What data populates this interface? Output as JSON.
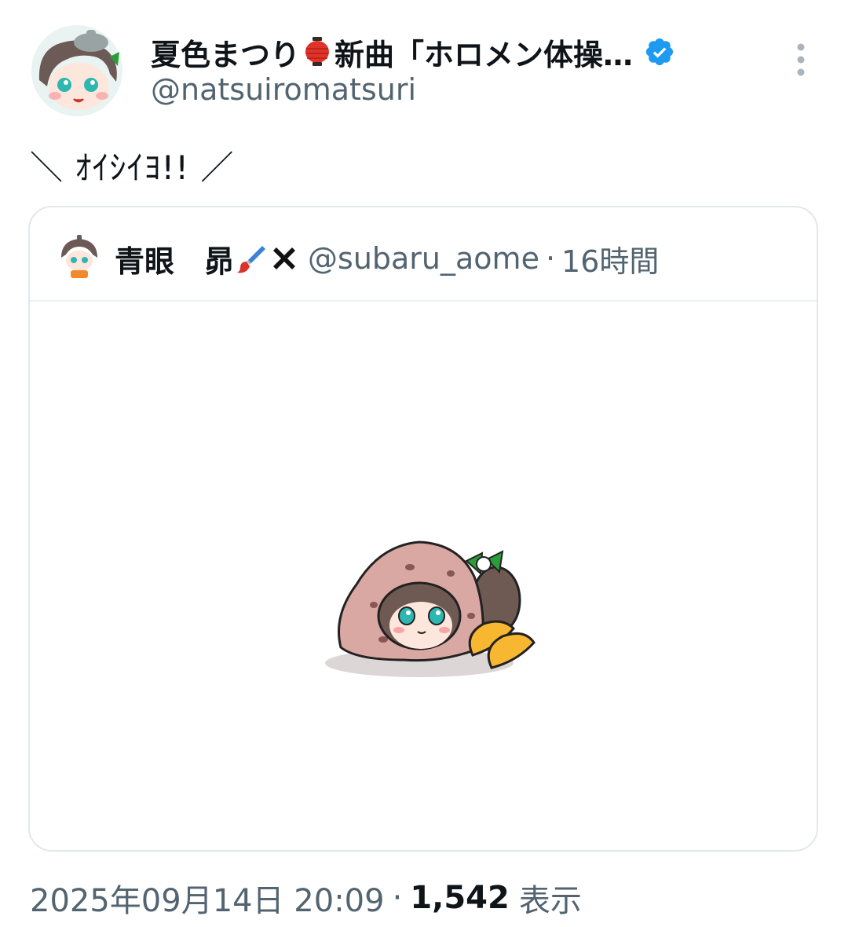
{
  "author": {
    "display_name_prefix": "夏色まつり",
    "display_name_suffix": "新曲「ホロメン体操…",
    "handle": "@natsuiromatsuri",
    "icons": {
      "name_emoji": "red-paper-lantern-icon",
      "verified": "verified-badge-icon",
      "more": "more-options-icon"
    }
  },
  "tweet": {
    "text": "＼ ｵｲｼｲﾖ!! ／"
  },
  "quoted": {
    "name": "青眼　昴",
    "handle": "@subaru_aome",
    "separator": "·",
    "time": "16時間",
    "icons": {
      "emoji_1": "paintbrush-icon",
      "emoji_2": "cross-mark-icon"
    }
  },
  "footer": {
    "date": "2025年09月14日 20:09",
    "separator": "·",
    "views": "1,542",
    "views_label": "表示"
  },
  "colors": {
    "primary_text": "#0f1419",
    "secondary_text": "#536471",
    "verified_blue": "#1d9bf0",
    "border": "#e1e8ed"
  }
}
